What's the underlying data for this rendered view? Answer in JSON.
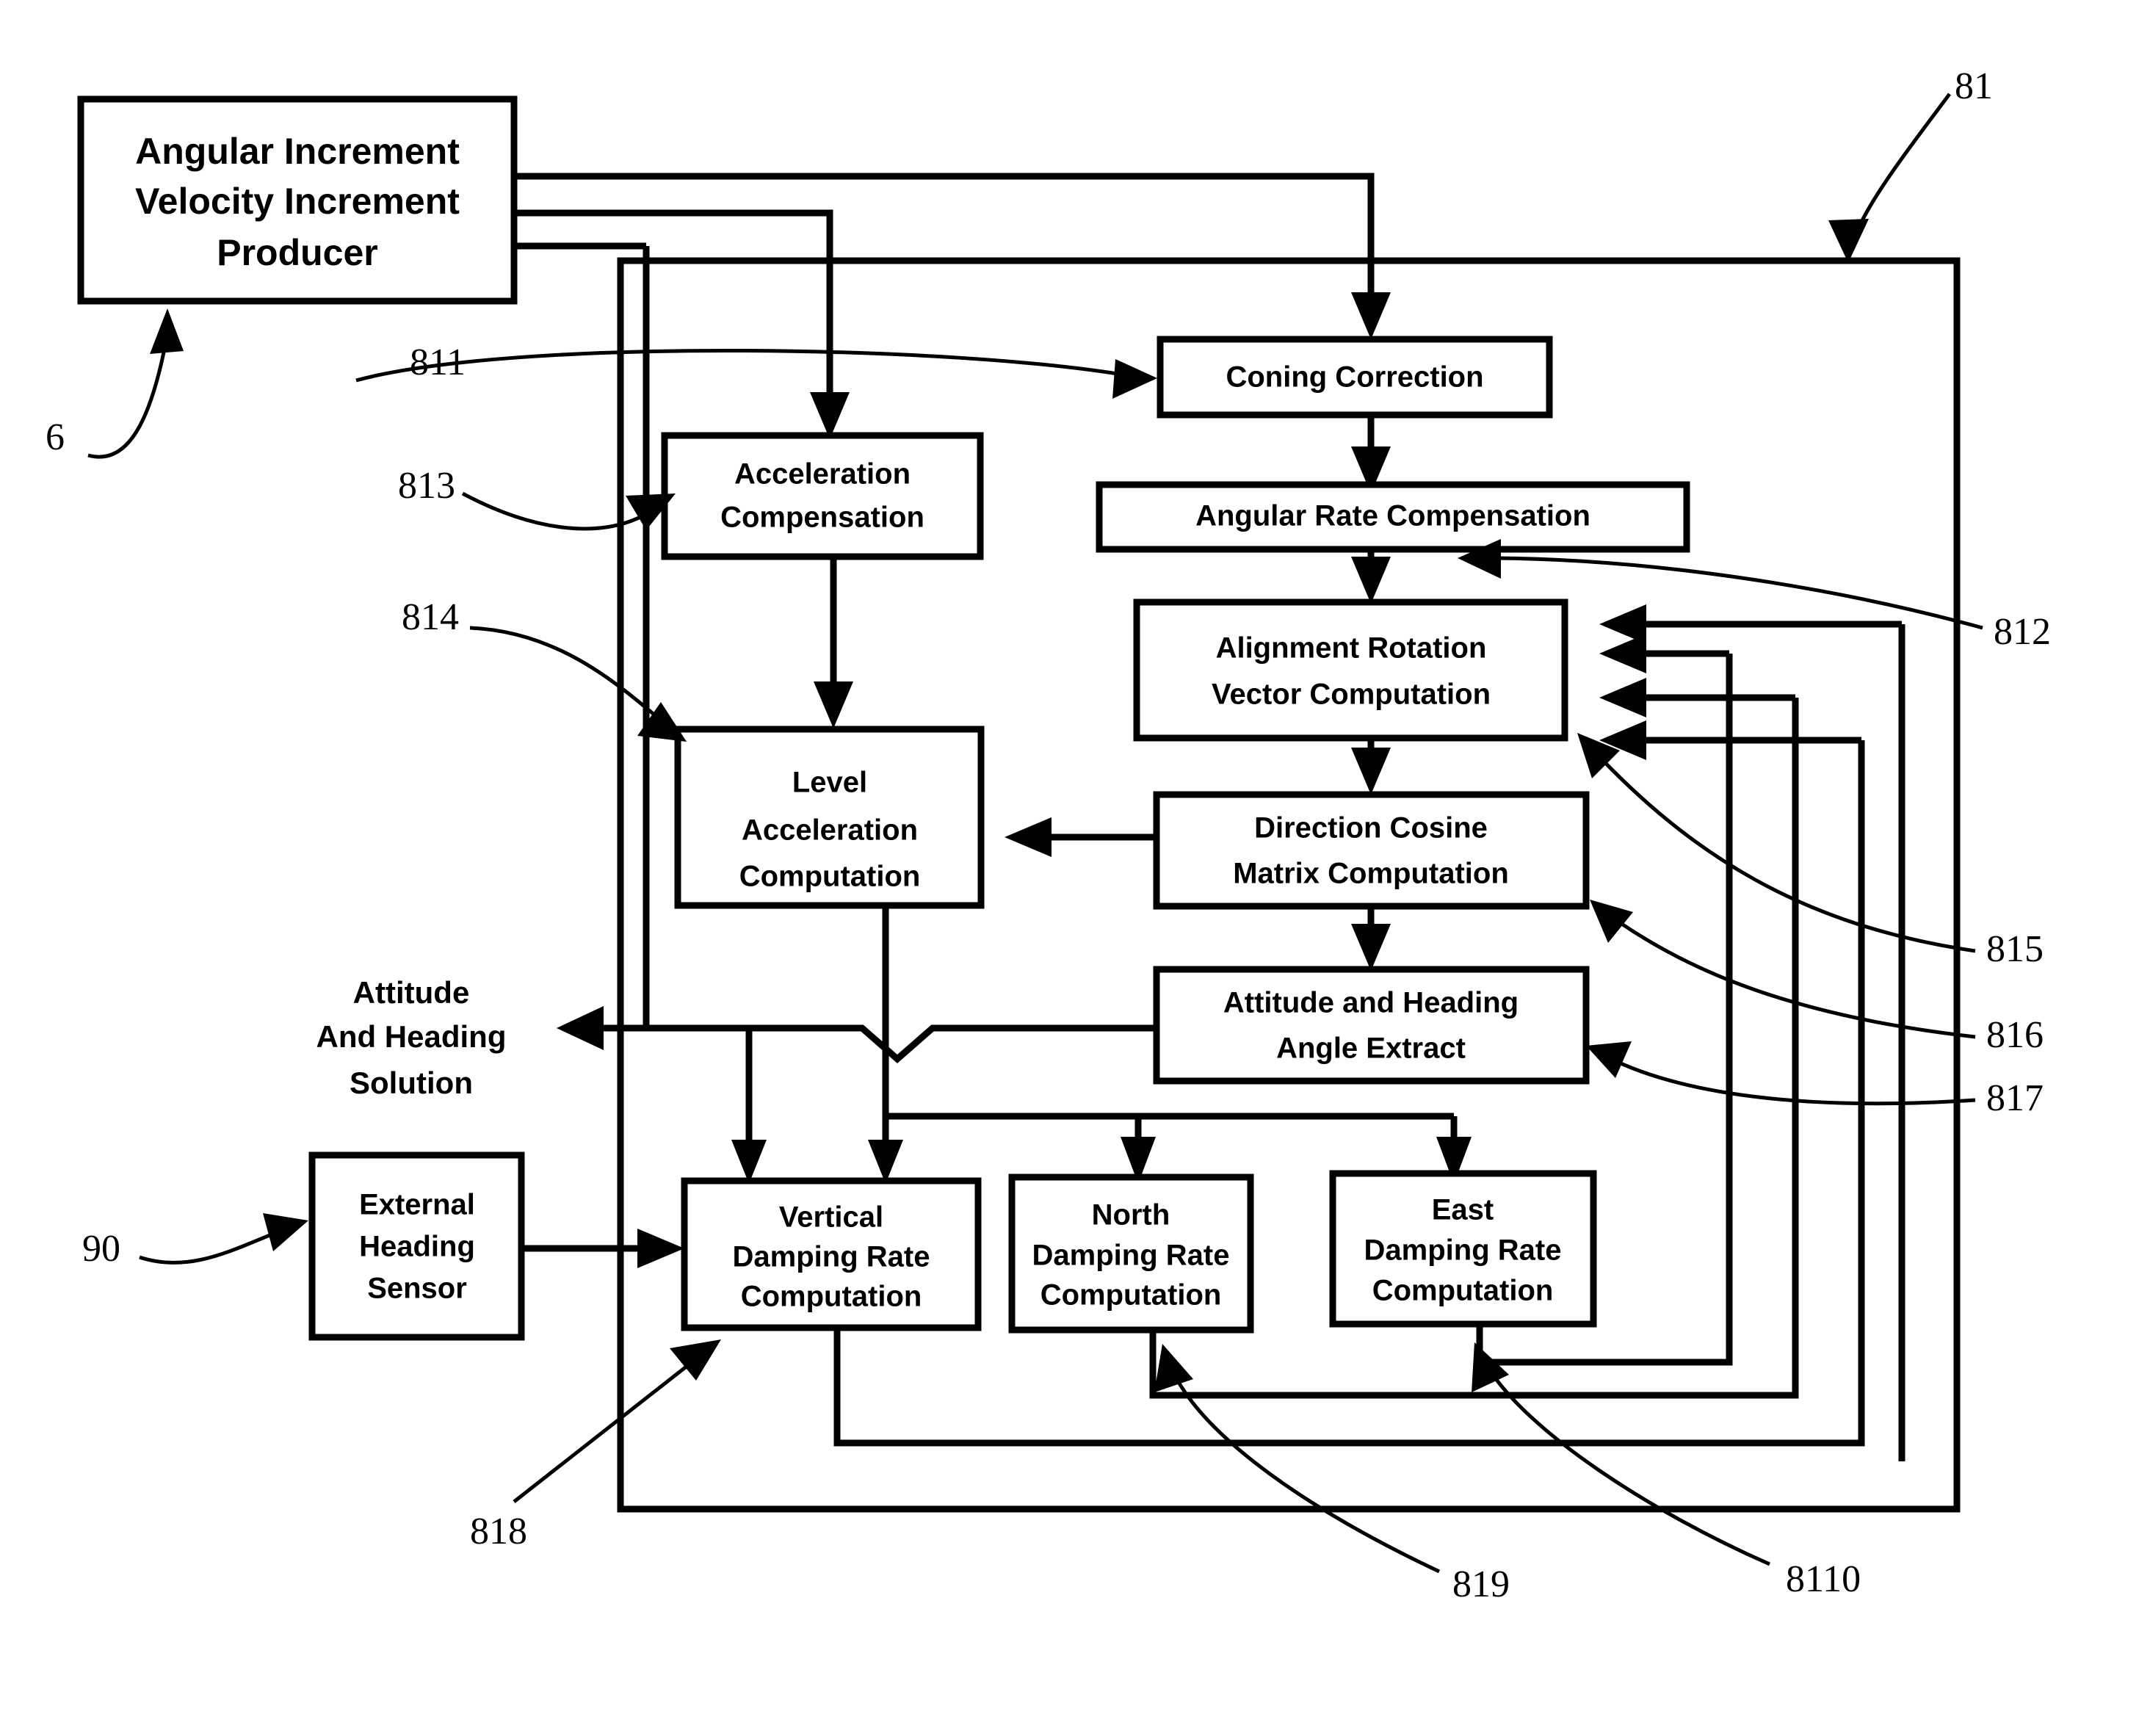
{
  "figure": {
    "type": "patent-block-diagram",
    "background_color": "#ffffff",
    "line_color": "#000000"
  },
  "blocks": {
    "producer": {
      "lines": [
        "Angular Increment",
        "Velocity Increment",
        "Producer"
      ]
    },
    "coning_correction": {
      "lines": [
        "Coning Correction"
      ]
    },
    "angular_rate_compensation": {
      "lines": [
        "Angular Rate Compensation"
      ]
    },
    "acceleration_compensation": {
      "lines": [
        "Acceleration",
        "Compensation"
      ]
    },
    "alignment_rotation": {
      "lines": [
        "Alignment Rotation",
        "Vector Computation"
      ]
    },
    "level_acceleration": {
      "lines": [
        "Level",
        "Acceleration",
        "Computation"
      ]
    },
    "direction_cosine": {
      "lines": [
        "Direction Cosine",
        "Matrix Computation"
      ]
    },
    "attitude_heading_extract": {
      "lines": [
        "Attitude and Heading",
        "Angle Extract"
      ]
    },
    "external_heading_sensor": {
      "lines": [
        "External",
        "Heading",
        "Sensor"
      ]
    },
    "vertical_damping": {
      "lines": [
        "Vertical",
        "Damping Rate",
        "Computation"
      ]
    },
    "north_damping": {
      "lines": [
        "North",
        "Damping Rate",
        "Computation"
      ]
    },
    "east_damping": {
      "lines": [
        "East",
        "Damping Rate",
        "Computation"
      ]
    }
  },
  "annotations": {
    "output_solution": {
      "lines": [
        "Attitude",
        "And Heading",
        "Solution"
      ]
    }
  },
  "reference_numerals": {
    "n6": "6",
    "n81": "81",
    "n90": "90",
    "n811": "811",
    "n812": "812",
    "n813": "813",
    "n814": "814",
    "n815": "815",
    "n816": "816",
    "n817": "817",
    "n818": "818",
    "n819": "819",
    "n8110": "8110"
  }
}
